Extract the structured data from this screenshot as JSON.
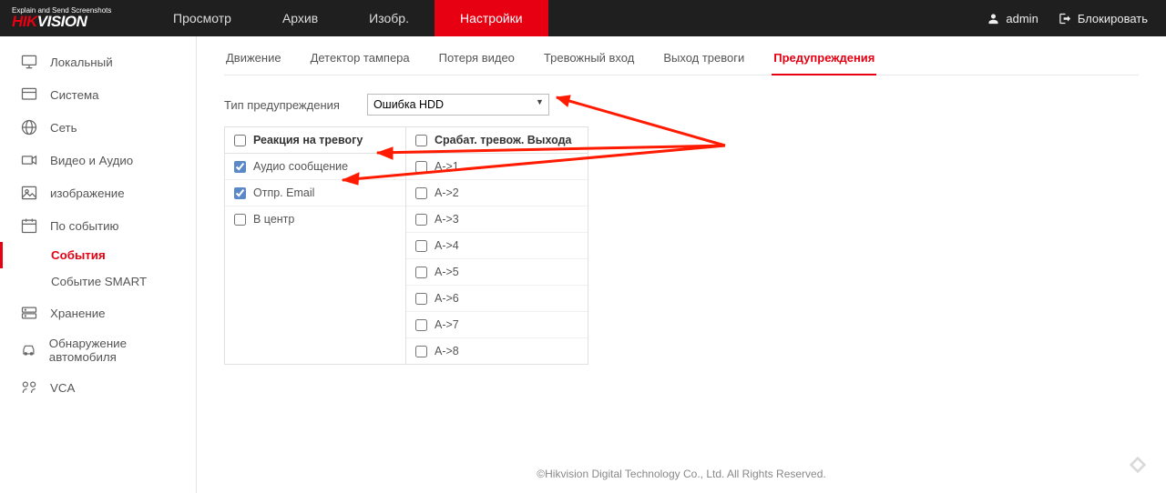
{
  "logo": {
    "tagline": "Explain and Send Screenshots",
    "brand_prefix": "HIK",
    "brand_suffix": "VISION"
  },
  "topnav": {
    "view": "Просмотр",
    "archive": "Архив",
    "image": "Изобр.",
    "settings": "Настройки"
  },
  "topright": {
    "user": "admin",
    "lock": "Блокировать"
  },
  "sidebar": {
    "local": "Локальный",
    "system": "Система",
    "network": "Сеть",
    "video_audio": "Видео и Аудио",
    "image": "изображение",
    "by_event": "По событию",
    "events": "События",
    "smart_event": "Событие SMART",
    "storage": "Хранение",
    "vehicle": "Обнаружение автомобиля",
    "vca": "VCA"
  },
  "subtabs": {
    "motion": "Движение",
    "tamper": "Детектор тампера",
    "vloss": "Потеря видео",
    "alarm_in": "Тревожный вход",
    "alarm_out": "Выход тревоги",
    "exception": "Предупреждения"
  },
  "form": {
    "type_label": "Тип предупреждения",
    "type_value": "Ошибка HDD",
    "colA_head": "Реакция на тревогу",
    "colB_head": "Срабат. тревож. Выхода",
    "audio": "Аудио сообщение",
    "email": "Отпр. Email",
    "center": "В центр",
    "out1": "A->1",
    "out2": "A->2",
    "out3": "A->3",
    "out4": "A->4",
    "out5": "A->5",
    "out6": "A->6",
    "out7": "A->7",
    "out8": "A->8"
  },
  "footer": "©Hikvision Digital Technology Co., Ltd. All Rights Reserved."
}
